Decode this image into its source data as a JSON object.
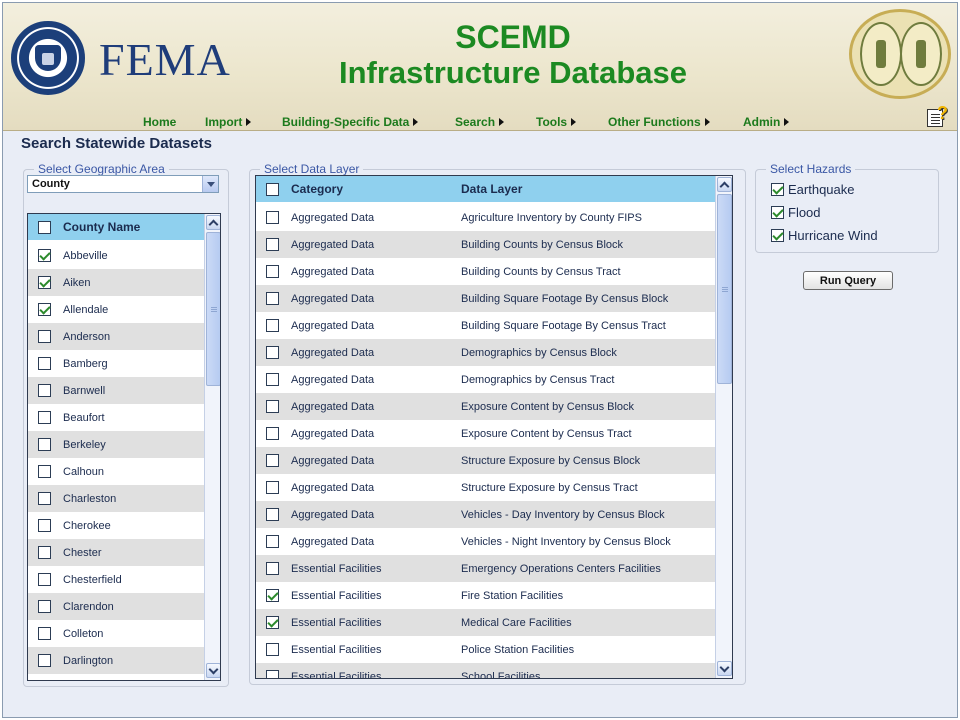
{
  "header": {
    "agency": "FEMA",
    "title_line1": "SCEMD",
    "title_line2": "Infrastructure Database"
  },
  "nav": [
    {
      "label": "Home",
      "submenu": false
    },
    {
      "label": "Import",
      "submenu": true
    },
    {
      "label": "Building-Specific Data",
      "submenu": true
    },
    {
      "label": "Search",
      "submenu": true
    },
    {
      "label": "Tools",
      "submenu": true
    },
    {
      "label": "Other Functions",
      "submenu": true
    },
    {
      "label": "Admin",
      "submenu": true
    }
  ],
  "page_title": "Search Statewide Datasets",
  "geo": {
    "legend": "Select Geographic Area",
    "selected": "County",
    "column_header": "County Name",
    "counties": [
      {
        "name": "Abbeville",
        "checked": true
      },
      {
        "name": "Aiken",
        "checked": true
      },
      {
        "name": "Allendale",
        "checked": true
      },
      {
        "name": "Anderson",
        "checked": false
      },
      {
        "name": "Bamberg",
        "checked": false
      },
      {
        "name": "Barnwell",
        "checked": false
      },
      {
        "name": "Beaufort",
        "checked": false
      },
      {
        "name": "Berkeley",
        "checked": false
      },
      {
        "name": "Calhoun",
        "checked": false
      },
      {
        "name": "Charleston",
        "checked": false
      },
      {
        "name": "Cherokee",
        "checked": false
      },
      {
        "name": "Chester",
        "checked": false
      },
      {
        "name": "Chesterfield",
        "checked": false
      },
      {
        "name": "Clarendon",
        "checked": false
      },
      {
        "name": "Colleton",
        "checked": false
      },
      {
        "name": "Darlington",
        "checked": false
      }
    ]
  },
  "layers": {
    "legend": "Select Data Layer",
    "col_category": "Category",
    "col_layer": "Data Layer",
    "rows": [
      {
        "category": "Aggregated Data",
        "layer": "Agriculture Inventory by County FIPS",
        "checked": false
      },
      {
        "category": "Aggregated Data",
        "layer": "Building Counts by Census Block",
        "checked": false
      },
      {
        "category": "Aggregated Data",
        "layer": "Building Counts by Census Tract",
        "checked": false
      },
      {
        "category": "Aggregated Data",
        "layer": "Building Square Footage By Census Block",
        "checked": false
      },
      {
        "category": "Aggregated Data",
        "layer": "Building Square Footage By Census Tract",
        "checked": false
      },
      {
        "category": "Aggregated Data",
        "layer": "Demographics by Census Block",
        "checked": false
      },
      {
        "category": "Aggregated Data",
        "layer": "Demographics by Census Tract",
        "checked": false
      },
      {
        "category": "Aggregated Data",
        "layer": "Exposure Content by Census Block",
        "checked": false
      },
      {
        "category": "Aggregated Data",
        "layer": "Exposure Content by Census Tract",
        "checked": false
      },
      {
        "category": "Aggregated Data",
        "layer": "Structure Exposure by Census Block",
        "checked": false
      },
      {
        "category": "Aggregated Data",
        "layer": "Structure Exposure by Census Tract",
        "checked": false
      },
      {
        "category": "Aggregated Data",
        "layer": "Vehicles - Day Inventory by Census Block",
        "checked": false
      },
      {
        "category": "Aggregated Data",
        "layer": "Vehicles - Night Inventory by Census Block",
        "checked": false
      },
      {
        "category": "Essential Facilities",
        "layer": "Emergency Operations Centers Facilities",
        "checked": false
      },
      {
        "category": "Essential Facilities",
        "layer": "Fire Station Facilities",
        "checked": true
      },
      {
        "category": "Essential Facilities",
        "layer": "Medical Care Facilities",
        "checked": true
      },
      {
        "category": "Essential Facilities",
        "layer": "Police Station Facilities",
        "checked": false
      },
      {
        "category": "Essential Facilities",
        "layer": "School Facilities",
        "checked": false
      }
    ]
  },
  "hazards": {
    "legend": "Select Hazards",
    "items": [
      {
        "label": "Earthquake",
        "checked": true
      },
      {
        "label": "Flood",
        "checked": true
      },
      {
        "label": "Hurricane Wind",
        "checked": true
      }
    ]
  },
  "run_query_label": "Run Query",
  "colors": {
    "title_green": "#1c8a22",
    "nav_green": "#1c7a1c",
    "table_header": "#8fd0ee",
    "legend_blue": "#3a57a5"
  }
}
